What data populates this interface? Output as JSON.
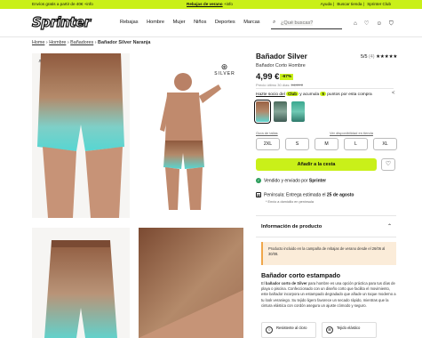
{
  "promo": {
    "left": "Envíos gratis a partir de 40€ +info",
    "center_bold": "Rebajas de verano",
    "center_rest": " +info",
    "links": [
      "Ayuda",
      "Buscar tienda",
      "Sprinter Club"
    ]
  },
  "header": {
    "logo": "Sprinter",
    "nav": [
      "Rebajas",
      "Hombre",
      "Mujer",
      "Niños",
      "Deportes",
      "Marcas"
    ],
    "search_placeholder": "¿Qué buscas?"
  },
  "breadcrumb": {
    "items": [
      "Home",
      "Hombre",
      "Bañadores"
    ],
    "current": "Bañador Silver Naranja",
    "separator": "›"
  },
  "product": {
    "title": "Bañador Silver",
    "rating": "5/5",
    "rating_count": "(4)",
    "stars": 5,
    "subtitle": "Bañador Corto Hombre",
    "price": "4,99 €",
    "discount": "-67%",
    "prev_price_label": "Precio último 30 días:",
    "prev_price": "14,99 €",
    "club_link": "Hazte socio del",
    "club_badge": "Club",
    "club_rest": "y acumula",
    "club_points": "5",
    "club_end": "puntos por esta compra",
    "size_guide": "Guía de tallas",
    "availability": "Ver disponibilidad en tienda",
    "sizes": [
      "2XL",
      "S",
      "M",
      "L",
      "XL"
    ],
    "add_to_cart": "Añadir a la cesta",
    "sold_by_prefix": "Vendido y enviado por",
    "sold_by": "Sprinter",
    "delivery_prefix": "Península: Entrega estimada el",
    "delivery_date": "25 de agosto",
    "delivery_note": "* Envío a domicilio en península",
    "brand_logo": "SILVER"
  },
  "info": {
    "heading": "Información de producto",
    "notice": "Producto incluido en la campaña de rebajas de verano desde el 26/06 al 30/08.",
    "h2": "Bañador corto estampado",
    "desc_pre": "El ",
    "desc_bold": "bañador corto de Silver",
    "desc_rest": " para hombre es una opción práctica para tus días de playa o piscina. Confeccionado con un diseño corto que facilita el movimiento, este bañador incorpora un estampado degradado que añade un toque moderno a tu look veraniego. Su tejido ligero favorece un secado rápido, mientras que la cintura elástica con cordón asegura un ajuste cómodo y seguro.",
    "features": [
      "Resistente al cloro",
      "Tejido elástico"
    ]
  },
  "colors": {
    "accent": "#c9f019",
    "notice_bg": "#fbecd9",
    "notice_border": "#f0a64a",
    "shorts_top": "#9a6244",
    "shorts_bottom": "#5fd5cf"
  },
  "icons": [
    "search-icon",
    "store-icon",
    "heart-icon",
    "user-icon",
    "cart-icon",
    "zoom-icon",
    "share-icon",
    "truck-icon",
    "calendar-icon",
    "chevron-up-icon"
  ]
}
